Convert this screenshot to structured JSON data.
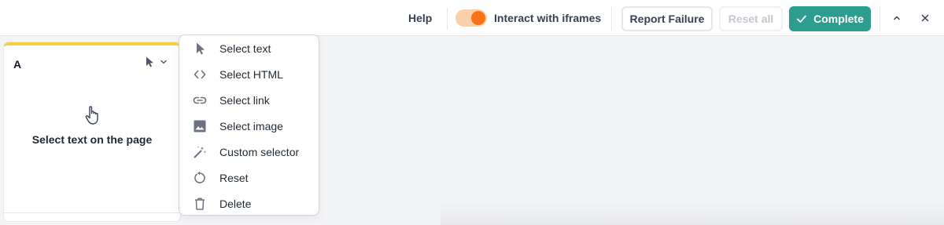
{
  "topbar": {
    "help_label": "Help",
    "iframes_toggle": {
      "label": "Interact with iframes",
      "on": true
    },
    "report_failure_label": "Report Failure",
    "reset_all_label": "Reset all",
    "complete_label": "Complete"
  },
  "colors": {
    "accent": "#2d9d8f",
    "toggle_on": "#f97316",
    "card_highlight": "#f7cf45"
  },
  "card": {
    "title": "A",
    "tool_icon": "pointer-icon",
    "message": "Select text on the page"
  },
  "menu": {
    "items": [
      {
        "label": "Select text",
        "icon": "pointer-icon"
      },
      {
        "label": "Select HTML",
        "icon": "code-icon"
      },
      {
        "label": "Select link",
        "icon": "link-icon"
      },
      {
        "label": "Select image",
        "icon": "image-icon"
      },
      {
        "label": "Custom selector",
        "icon": "magic-wand-icon"
      },
      {
        "label": "Reset",
        "icon": "reset-icon"
      },
      {
        "label": "Delete",
        "icon": "trash-icon"
      }
    ]
  }
}
